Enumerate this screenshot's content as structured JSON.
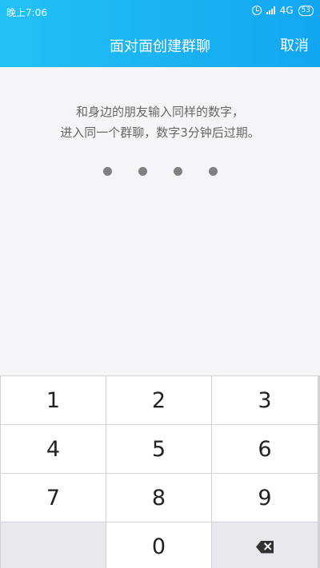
{
  "status_bar": {
    "time": "晚上7:06",
    "network": "4G",
    "battery": "53",
    "icons": [
      "alarm-icon",
      "signal-icon",
      "battery-icon"
    ]
  },
  "navbar": {
    "title": "面对面创建群聊",
    "cancel_label": "取消"
  },
  "hint": {
    "line1": "和身边的朋友输入同样的数字，",
    "line2": "进入同一个群聊，数字3分钟后过期。"
  },
  "pin": {
    "length": 4,
    "entered": 0
  },
  "keypad": {
    "keys": [
      "1",
      "2",
      "3",
      "4",
      "5",
      "6",
      "7",
      "8",
      "9",
      "0"
    ],
    "delete_icon": "backspace-icon"
  },
  "colors": {
    "header_start": "#23c0f6",
    "header_end": "#13a6f0",
    "background": "#f4f5f9"
  }
}
